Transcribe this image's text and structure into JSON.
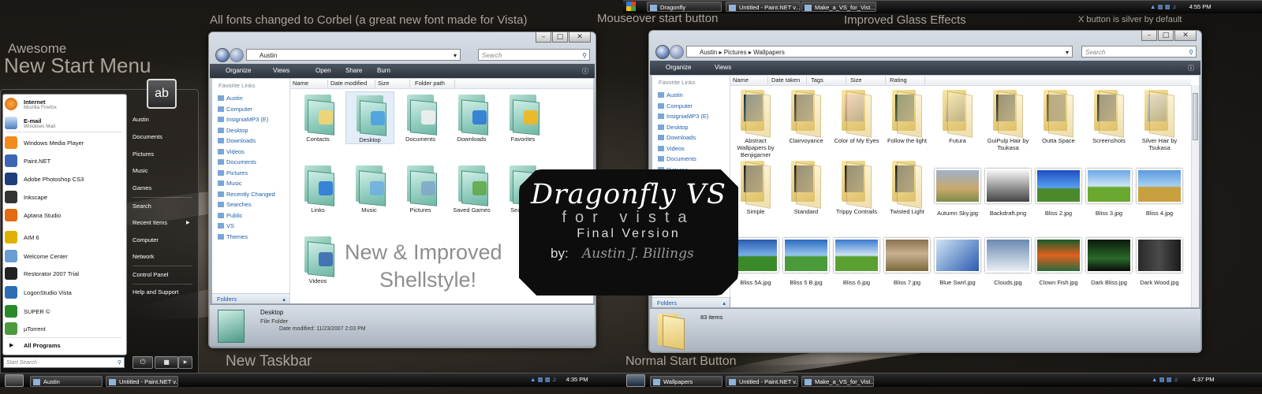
{
  "captions": {
    "awesome": "Awesome",
    "new_start_menu": "New Start Menu",
    "fonts": "All fonts changed to Corbel (a great new font made for Vista)",
    "mouseover": "Mouseover start button",
    "glass": "Improved Glass Effects",
    "xbutton": "X button is silver by default",
    "new_taskbar": "New Taskbar",
    "normal_start": "Normal Start Button",
    "shellstyle_1": "New & Improved",
    "shellstyle_2": "Shellstyle!"
  },
  "logo": {
    "title": "Dragonfly VS",
    "subtitle": "for vista",
    "version": "Final Version",
    "by": "by:",
    "author": "Austin J. Billings"
  },
  "start_menu": {
    "pinned": [
      {
        "title": "Internet",
        "sub": "Mozilla Firefox",
        "color": "#e8731c"
      },
      {
        "title": "E-mail",
        "sub": "Windows Mail",
        "color": "#4a7fc0"
      }
    ],
    "recent": [
      {
        "label": "Windows Media Player",
        "color": "#f28b1f"
      },
      {
        "label": "Paint.NET",
        "color": "#3b66b5"
      },
      {
        "label": "Adobe Photoshop CS3",
        "color": "#1c3e7a"
      },
      {
        "label": "Inkscape",
        "color": "#333333"
      },
      {
        "label": "Aptana Studio",
        "color": "#e56a10"
      },
      {
        "label": "AIM 6",
        "color": "#e0b000"
      },
      {
        "label": "Welcome Center",
        "color": "#6a9cd6"
      },
      {
        "label": "Restorator 2007 Trial",
        "color": "#222222"
      },
      {
        "label": "LogonStudio Vista",
        "color": "#2d6db5"
      },
      {
        "label": "SUPER ©",
        "color": "#2a8a2a"
      },
      {
        "label": "µTorrent",
        "color": "#4a9b3a"
      }
    ],
    "all_programs": "All Programs",
    "search_placeholder": "Start Search",
    "right": [
      "Austin",
      "Documents",
      "Pictures",
      "Music",
      "Games",
      "Search",
      "Recent Items",
      "Computer",
      "Network",
      "Control Panel",
      "Help and Support"
    ],
    "user_tile": "ab"
  },
  "window1": {
    "path": "Austin",
    "search_placeholder": "Search",
    "toolbar": [
      "Organize",
      "Views",
      "Open",
      "Share",
      "Burn"
    ],
    "nav_header": "Favorite Links",
    "nav": [
      "Austin",
      "Computer",
      "InsigniaMP3 (E)",
      "Desktop",
      "Downloads",
      "Videos",
      "Documents",
      "Pictures",
      "Music",
      "Recently Changed",
      "Searches",
      "Public",
      "VS",
      "Themes"
    ],
    "folders_label": "Folders",
    "columns": [
      "Name",
      "Date modified",
      "Size",
      "Folder path"
    ],
    "items": [
      "Contacts",
      "Desktop",
      "Documents",
      "Downloads",
      "Favorites",
      "Links",
      "Music",
      "Pictures",
      "Saved Games",
      "Searches",
      "Videos"
    ],
    "details": {
      "name": "Desktop",
      "type": "File Folder",
      "modified": "Date modified:  11/23/2007 2:03 PM"
    }
  },
  "window2": {
    "path": [
      "Austin",
      "Pictures",
      "Wallpapers"
    ],
    "search_placeholder": "Search",
    "toolbar": [
      "Organize",
      "Views"
    ],
    "nav_header": "Favorite Links",
    "nav": [
      "Austin",
      "Computer",
      "InsigniaMP3 (E)",
      "Desktop",
      "Downloads",
      "Videos",
      "Documents",
      "Pictures"
    ],
    "folders_label": "Folders",
    "columns": [
      "Name",
      "Date taken",
      "Tags",
      "Size",
      "Rating"
    ],
    "folders_row1": [
      "Abstract Wallpapers by Benjigarner",
      "Clairvoyance",
      "Color of My Eyes",
      "Follow the light",
      "Futura",
      "GuiPulp Hair by Tsukasa",
      "Outta Space",
      "Screenshots",
      "Silver Hair by Tsukasa"
    ],
    "row2": [
      "Simple",
      "Standard",
      "Trippy Contrails",
      "Twisted Light",
      "Autumn Sky.jpg",
      "Backdraft.png",
      "Bliss 2.jpg",
      "Bliss 3.jpg",
      "Bliss 4.jpg"
    ],
    "row3": [
      "Bliss 5A.jpg",
      "Bliss 5 B.jpg",
      "Bliss 6.jpg",
      "Bliss 7.jpg",
      "Blue Swirl.jpg",
      "Clouds.jpg",
      "Clown Fish.jpg",
      "Dark Bliss.jpg",
      "Dark Wood.jpg"
    ],
    "items_count": "83 items"
  },
  "taskbar_left": {
    "buttons": [
      "Austin",
      "Untitled - Paint.NET v..."
    ],
    "clock": "4:35 PM"
  },
  "taskbar_right": {
    "buttons": [
      "Wallpapers",
      "Untitled - Paint.NET v...",
      "Make_a_VS_for_Vist..."
    ],
    "clock": "4:37 PM"
  },
  "taskbar_top": {
    "buttons": [
      "Dragonfly",
      "Untitled - Paint.NET v...",
      "Make_a_VS_for_Vist..."
    ],
    "clock": "4:55 PM"
  }
}
